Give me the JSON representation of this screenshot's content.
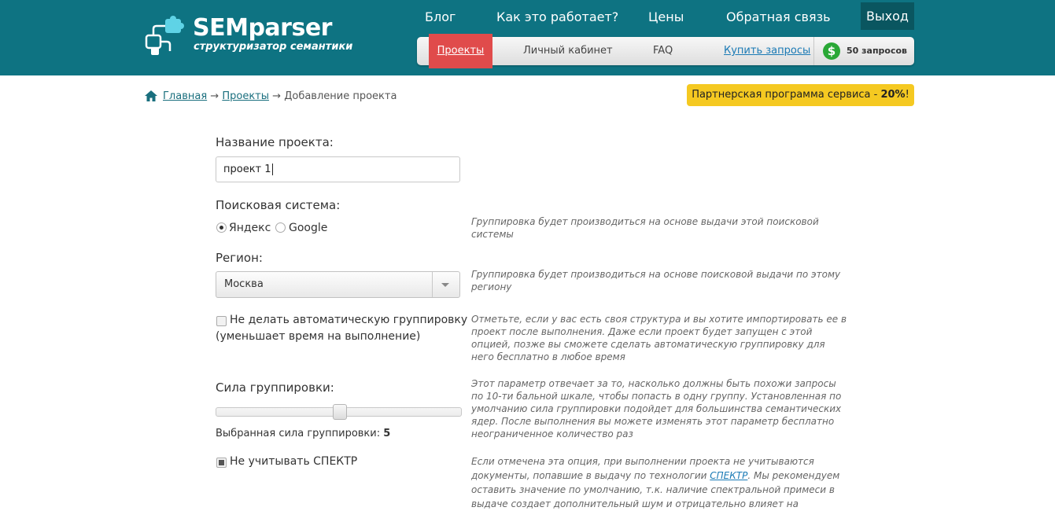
{
  "brand": {
    "name": "SEMparser",
    "tagline": "структуризатор семантики"
  },
  "topnav": {
    "blog": "Блог",
    "how": "Как это работает?",
    "prices": "Цены",
    "feedback": "Обратная связь",
    "exit": "Выход"
  },
  "subnav": {
    "projects": "Проекты",
    "cabinet": "Личный кабинет",
    "faq": "FAQ",
    "buy": "Купить запросы",
    "requests": "50 запросов",
    "coin_symbol": "$"
  },
  "breadcrumb": {
    "home": "Главная",
    "projects": "Проекты",
    "current": "Добавление проекта",
    "separator": "→"
  },
  "partner": {
    "text": "Партнерская программа сервиса - ",
    "percent": "20%",
    "suffix": "!"
  },
  "form": {
    "name_label": "Название проекта:",
    "name_value": "проект 1",
    "search_label": "Поисковая система:",
    "engines": [
      "Яндекс",
      "Google"
    ],
    "selected_engine": "Яндекс",
    "search_hint": "Группировка будет производиться на основе выдачи этой поисковой системы",
    "region_label": "Регион:",
    "region_value": "Москва",
    "region_hint": "Группировка будет производиться на основе поисковой выдачи по этому региону",
    "nogroup_label_1": "Не делать автоматическую группировку",
    "nogroup_label_2": "(уменьшает время на выполнение)",
    "nogroup_checked": false,
    "nogroup_hint": "Отметьте, если у вас есть своя структура и вы хотите импортировать ее в проект после выполнения. Даже если проект будет запущен с этой опцией, позже вы сможете сделать автоматическую группировку для него бесплатно в любое время",
    "strength_label": "Сила группировки:",
    "strength_hint": "Этот параметр отвечает за то, насколько должны быть похожи запросы по 10-ти бальной шкале, чтобы попасть в одну группу. Установленная по умолчанию сила группировки подойдет для большинства семантических ядер. После выполнения вы можете изменять этот параметр бесплатно неограниченное количество раз",
    "strength_text": "Выбранная сила группировки: ",
    "strength_value": "5",
    "spektr_label": "Не учитывать СПЕКТР",
    "spektr_checked": true,
    "spektr_hint_1": "Если отмечена эта опция, при выполнении проекта не учитываются документы, попавшие в выдачу по технологии ",
    "spektr_link": "СПЕКТР",
    "spektr_hint_2": ". Мы рекомендуем оставить значение по умолчанию, т.к. наличие спектральной примеси в выдаче создает дополнительный шум и отрицательно влияет на"
  },
  "colors": {
    "header_bg": "#0e7382",
    "active_tab": "#e04b4b",
    "partner_bg": "#f5c921",
    "coin": "#2aa836"
  }
}
